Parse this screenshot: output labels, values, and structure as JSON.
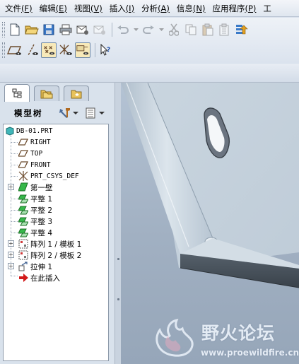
{
  "menubar": {
    "items": [
      {
        "label": "文件",
        "accel": "(F)"
      },
      {
        "label": "编辑",
        "accel": "(E)"
      },
      {
        "label": "视图",
        "accel": "(V)"
      },
      {
        "label": "插入",
        "accel": "(I)"
      },
      {
        "label": "分析",
        "accel": "(A)"
      },
      {
        "label": "信息",
        "accel": "(N)"
      },
      {
        "label": "应用程序",
        "accel": "(P)"
      },
      {
        "label": "工",
        "accel": ""
      }
    ]
  },
  "toolbar": {
    "row1_icons": [
      "new-file-icon",
      "open-folder-icon",
      "save-icon",
      "print-icon",
      "email-icon",
      "email-link-icon",
      "undo-icon",
      "redo-icon",
      "cut-icon",
      "copy-icon",
      "paste-icon",
      "paste-special-icon",
      "regenerate-icon"
    ],
    "row2_icons": [
      "datum-plane-display-icon",
      "datum-axis-display-icon",
      "datum-point-display-icon",
      "coordinate-system-display-icon",
      "annotation-display-icon",
      "context-help-icon"
    ]
  },
  "navigator": {
    "tabs": [
      "model-tree-tab",
      "folder-browser-tab",
      "favorites-tab"
    ],
    "title": "模型树",
    "tree": {
      "root": "DB-01.PRT",
      "items": [
        {
          "label": "RIGHT",
          "icon": "datum-plane-icon"
        },
        {
          "label": "TOP",
          "icon": "datum-plane-icon"
        },
        {
          "label": "FRONT",
          "icon": "datum-plane-icon"
        },
        {
          "label": "PRT_CSYS_DEF",
          "icon": "coordinate-system-icon"
        },
        {
          "label": "第一壁",
          "icon": "first-wall-icon"
        },
        {
          "label": "平整 1",
          "icon": "flat-wall-icon"
        },
        {
          "label": "平整 2",
          "icon": "flat-wall-icon"
        },
        {
          "label": "平整 3",
          "icon": "flat-wall-icon"
        },
        {
          "label": "平整 4",
          "icon": "flat-wall-icon"
        },
        {
          "label": "阵列 1 / 模板 1",
          "icon": "pattern-icon"
        },
        {
          "label": "阵列 2 / 模板 2",
          "icon": "pattern-icon"
        },
        {
          "label": "拉伸 1",
          "icon": "extrude-icon"
        },
        {
          "label": "在此插入",
          "icon": "insert-here-arrow-icon"
        }
      ]
    }
  },
  "watermark": {
    "brand": "野火论坛",
    "url": "www.proewildfire.cn"
  },
  "colors": {
    "accent": "#f7e9b9",
    "part_surface": "#c7d4de",
    "insert_arrow": "#d21a1a",
    "datum_plane": "#6b4a2c"
  }
}
